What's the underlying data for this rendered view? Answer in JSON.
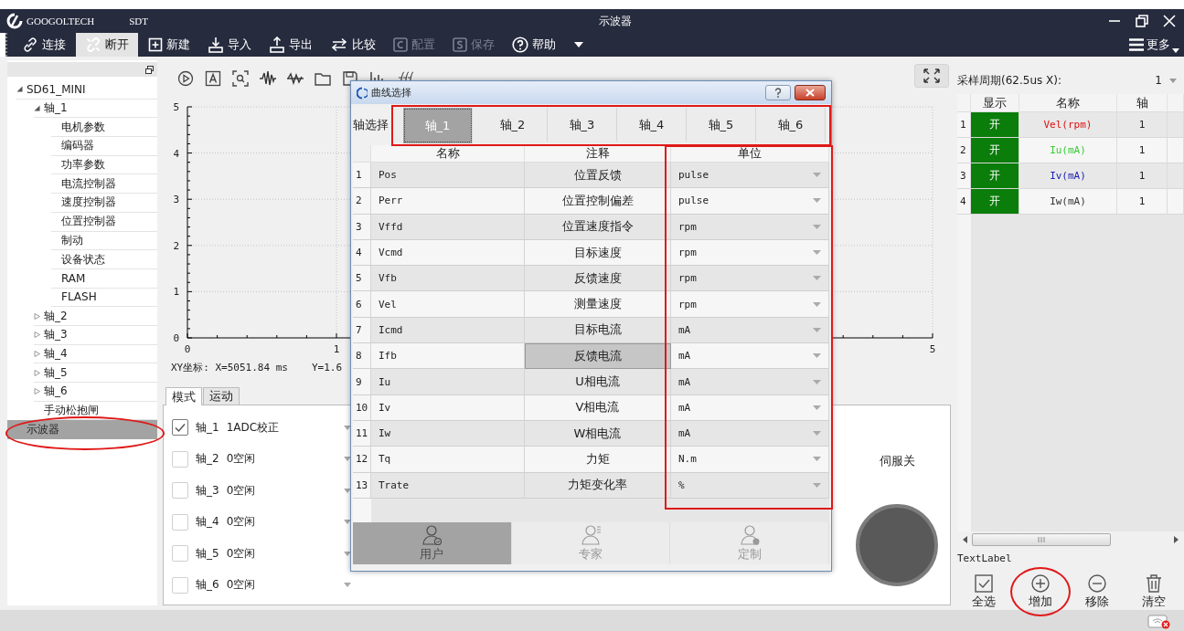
{
  "window": {
    "logo": "GOOGOLTECH",
    "product": "SDT",
    "title": "示波器"
  },
  "toolbar": {
    "items": [
      {
        "label": "连接",
        "selected": false,
        "disabled": false
      },
      {
        "label": "断开",
        "selected": true,
        "disabled": false
      },
      {
        "label": "新建",
        "selected": false,
        "disabled": false
      },
      {
        "label": "导入",
        "selected": false,
        "disabled": false
      },
      {
        "label": "导出",
        "selected": false,
        "disabled": false
      },
      {
        "label": "比较",
        "selected": false,
        "disabled": false
      },
      {
        "label": "配置",
        "selected": false,
        "disabled": true
      },
      {
        "label": "保存",
        "selected": false,
        "disabled": true
      },
      {
        "label": "帮助",
        "selected": false,
        "disabled": false
      }
    ],
    "more": "更多"
  },
  "tree": {
    "items": [
      {
        "label": "SD61_MINI",
        "expanded": true,
        "selected": false,
        "circled": false,
        "children": [
          {
            "label": "轴_1",
            "expanded": true,
            "selected": false,
            "circled": false,
            "children": [
              {
                "label": "电机参数",
                "selected": false,
                "circled": false
              },
              {
                "label": "编码器",
                "selected": false,
                "circled": false
              },
              {
                "label": "功率参数",
                "selected": false,
                "circled": false
              },
              {
                "label": "电流控制器",
                "selected": false,
                "circled": false
              },
              {
                "label": "速度控制器",
                "selected": false,
                "circled": false
              },
              {
                "label": "位置控制器",
                "selected": false,
                "circled": false
              },
              {
                "label": "制动",
                "selected": false,
                "circled": false
              },
              {
                "label": "设备状态",
                "selected": false,
                "circled": false
              },
              {
                "label": "RAM",
                "selected": false,
                "circled": false
              },
              {
                "label": "FLASH",
                "selected": false,
                "circled": false
              }
            ]
          },
          {
            "label": "轴_2",
            "expanded": false,
            "selected": false,
            "circled": false
          },
          {
            "label": "轴_3",
            "expanded": false,
            "selected": false,
            "circled": false
          },
          {
            "label": "轴_4",
            "expanded": false,
            "selected": false,
            "circled": false
          },
          {
            "label": "轴_5",
            "expanded": false,
            "selected": false,
            "circled": false
          },
          {
            "label": "轴_6",
            "expanded": false,
            "selected": false,
            "circled": false
          },
          {
            "label": "手动松抱闸",
            "selected": false,
            "circled": false
          }
        ]
      },
      {
        "label": "示波器",
        "selected": true,
        "circled": true
      }
    ]
  },
  "chart": {
    "chart_data": {
      "type": "line",
      "xlim": [
        0,
        5
      ],
      "ylim": [
        0,
        5
      ],
      "grid": true,
      "xticks": [
        {
          "value": 0,
          "label": "0"
        },
        {
          "value": 1,
          "label": "1"
        },
        {
          "value": 5,
          "label": "5"
        }
      ],
      "yticks": [
        {
          "value": 0,
          "label": "0"
        },
        {
          "value": 1,
          "label": "1"
        },
        {
          "value": 2,
          "label": "2"
        },
        {
          "value": 3,
          "label": "3"
        },
        {
          "value": 4,
          "label": "4"
        },
        {
          "value": 5,
          "label": "5"
        }
      ]
    },
    "coord_x": "XY坐标: X=5051.84 ms",
    "coord_y": "Y=1.6"
  },
  "bottom_tabs": [
    {
      "label": "模式",
      "selected": true
    },
    {
      "label": "运动",
      "selected": false
    }
  ],
  "modes": [
    {
      "axis": "轴_1",
      "mode": "1ADC校正",
      "checked": true
    },
    {
      "axis": "轴_2",
      "mode": "0空闲",
      "checked": false
    },
    {
      "axis": "轴_3",
      "mode": "0空闲",
      "checked": false
    },
    {
      "axis": "轴_4",
      "mode": "0空闲",
      "checked": false
    },
    {
      "axis": "轴_5",
      "mode": "0空闲",
      "checked": false
    },
    {
      "axis": "轴_6",
      "mode": "0空闲",
      "checked": false
    }
  ],
  "servo": {
    "label": "伺服关"
  },
  "dialog": {
    "title": "曲线选择",
    "axis_label": "轴选择",
    "axis_tabs_boxed": true,
    "unit_column_boxed": true,
    "axis_tabs": [
      {
        "label": "轴_1",
        "selected": true
      },
      {
        "label": "轴_2",
        "selected": false
      },
      {
        "label": "轴_3",
        "selected": false
      },
      {
        "label": "轴_4",
        "selected": false
      },
      {
        "label": "轴_5",
        "selected": false
      },
      {
        "label": "轴_6",
        "selected": false
      }
    ],
    "columns": [
      "名称",
      "注释",
      "单位"
    ],
    "rows": [
      {
        "index": "1",
        "name": "Pos",
        "note": "位置反馈",
        "unit": "pulse",
        "selected": false
      },
      {
        "index": "2",
        "name": "Perr",
        "note": "位置控制偏差",
        "unit": "pulse",
        "selected": false
      },
      {
        "index": "3",
        "name": "Vffd",
        "note": "位置速度指令",
        "unit": "rpm",
        "selected": false
      },
      {
        "index": "4",
        "name": "Vcmd",
        "note": "目标速度",
        "unit": "rpm",
        "selected": false
      },
      {
        "index": "5",
        "name": "Vfb",
        "note": "反馈速度",
        "unit": "rpm",
        "selected": false
      },
      {
        "index": "6",
        "name": "Vel",
        "note": "测量速度",
        "unit": "rpm",
        "selected": false
      },
      {
        "index": "7",
        "name": "Icmd",
        "note": "目标电流",
        "unit": "mA",
        "selected": false
      },
      {
        "index": "8",
        "name": "Ifb",
        "note": "反馈电流",
        "unit": "mA",
        "selected": true
      },
      {
        "index": "9",
        "name": "Iu",
        "note": "U相电流",
        "unit": "mA",
        "selected": false
      },
      {
        "index": "10",
        "name": "Iv",
        "note": "V相电流",
        "unit": "mA",
        "selected": false
      },
      {
        "index": "11",
        "name": "Iw",
        "note": "W相电流",
        "unit": "mA",
        "selected": false
      },
      {
        "index": "12",
        "name": "Tq",
        "note": "力矩",
        "unit": "N.m",
        "selected": false
      },
      {
        "index": "13",
        "name": "Trate",
        "note": "力矩变化率",
        "unit": "%",
        "selected": false
      }
    ],
    "levels": [
      {
        "label": "用户",
        "kind": "user",
        "selected": true
      },
      {
        "label": "专家",
        "kind": "expert",
        "selected": false
      },
      {
        "label": "定制",
        "kind": "custom",
        "selected": false
      }
    ]
  },
  "sampling": {
    "label": "采样周期(62.5us X):",
    "value": "1"
  },
  "channels": {
    "columns": [
      "显示",
      "名称",
      "轴"
    ],
    "rows": [
      {
        "index": "1",
        "show": "开",
        "on": true,
        "name": "Vel(rpm)",
        "color": "#e01010",
        "axis": "1"
      },
      {
        "index": "2",
        "show": "开",
        "on": true,
        "name": "Iu(mA)",
        "color": "#33cc33",
        "axis": "1"
      },
      {
        "index": "3",
        "show": "开",
        "on": true,
        "name": "Iv(mA)",
        "color": "#2020b0",
        "axis": "1"
      },
      {
        "index": "4",
        "show": "开",
        "on": true,
        "name": "Iw(mA)",
        "color": "#333333",
        "axis": "1"
      }
    ]
  },
  "text_label": "TextLabel",
  "actions": [
    {
      "label": "全选",
      "circled": false
    },
    {
      "label": "增加",
      "circled": true
    },
    {
      "label": "移除",
      "circled": false
    },
    {
      "label": "清空",
      "circled": false
    }
  ]
}
